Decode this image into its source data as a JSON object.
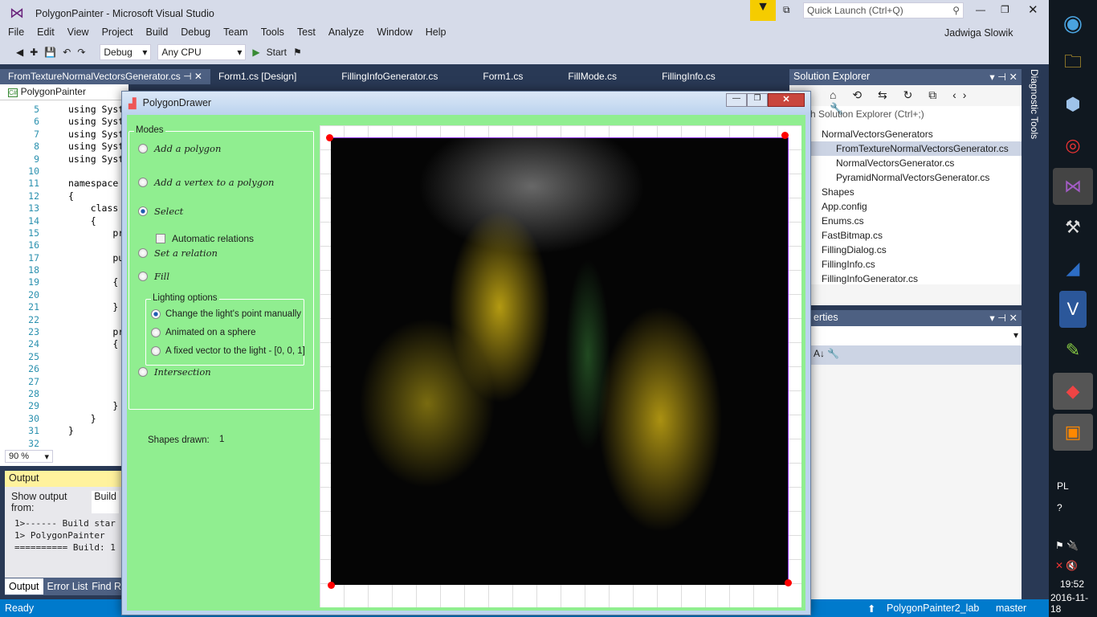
{
  "vs": {
    "title": "PolygonPainter - Microsoft Visual Studio",
    "quick_launch": "Quick Launch (Ctrl+Q)",
    "user": "Jadwiga Slowik",
    "menu": [
      "File",
      "Edit",
      "View",
      "Project",
      "Build",
      "Debug",
      "Team",
      "Tools",
      "Test",
      "Analyze",
      "Window",
      "Help"
    ],
    "config": "Debug",
    "platform": "Any CPU",
    "start": "Start",
    "tabs": [
      "FromTextureNormalVectorsGenerator.cs",
      "Form1.cs [Design]",
      "FillingInfoGenerator.cs",
      "Form1.cs",
      "FillMode.cs",
      "FillingInfo.cs"
    ],
    "project_combo": "PolygonPainter",
    "code_lines": [
      {
        "n": "5",
        "t": "using Syst",
        "k": "kw"
      },
      {
        "n": "6",
        "t": "using Syst",
        "k": "dim"
      },
      {
        "n": "7",
        "t": "using Syst",
        "k": "dim"
      },
      {
        "n": "8",
        "t": "using Syst",
        "k": "dim"
      },
      {
        "n": "9",
        "t": "using Syst",
        "k": "dim"
      },
      {
        "n": "10",
        "t": "",
        "k": ""
      },
      {
        "n": "11",
        "t": "namespace",
        "k": "kw"
      },
      {
        "n": "12",
        "t": "{",
        "k": ""
      },
      {
        "n": "13",
        "t": "    class",
        "k": "kw"
      },
      {
        "n": "14",
        "t": "    {",
        "k": ""
      },
      {
        "n": "15",
        "t": "        pr",
        "k": "kw"
      },
      {
        "n": "16",
        "t": "",
        "k": ""
      },
      {
        "n": "17",
        "t": "        pu",
        "k": "kw"
      },
      {
        "n": "18",
        "t": "",
        "k": ""
      },
      {
        "n": "19",
        "t": "        {",
        "k": ""
      },
      {
        "n": "20",
        "t": "",
        "k": ""
      },
      {
        "n": "21",
        "t": "        }",
        "k": ""
      },
      {
        "n": "22",
        "t": "",
        "k": ""
      },
      {
        "n": "23",
        "t": "        pr",
        "k": "kw"
      },
      {
        "n": "24",
        "t": "        {",
        "k": ""
      },
      {
        "n": "25",
        "t": "",
        "k": ""
      },
      {
        "n": "26",
        "t": "",
        "k": ""
      },
      {
        "n": "27",
        "t": "",
        "k": ""
      },
      {
        "n": "28",
        "t": "",
        "k": ""
      },
      {
        "n": "29",
        "t": "        }",
        "k": ""
      },
      {
        "n": "30",
        "t": "    }",
        "k": ""
      },
      {
        "n": "31",
        "t": "}",
        "k": ""
      },
      {
        "n": "32",
        "t": "",
        "k": ""
      }
    ],
    "zoom": "90 %",
    "output": {
      "title": "Output",
      "show_from": "Show output from:",
      "source": "Build",
      "lines": [
        "1>------ Build star",
        "1>  PolygonPainter",
        "========== Build: 1"
      ],
      "tabs": [
        "Output",
        "Error List",
        "Find R"
      ]
    },
    "status": {
      "ready": "Ready",
      "project": "PolygonPainter2_lab",
      "branch": "master"
    },
    "solution_explorer": {
      "title": "Solution Explorer",
      "search": "ch Solution Explorer (Ctrl+;)",
      "items": [
        "NormalVectorsGenerators",
        "FromTextureNormalVectorsGenerator.cs",
        "NormalVectorsGenerator.cs",
        "PyramidNormalVectorsGenerator.cs",
        "Shapes",
        "App.config",
        "Enums.cs",
        "FastBitmap.cs",
        "FillingDialog.cs",
        "FillingInfo.cs",
        "FillingInfoGenerator.cs"
      ]
    },
    "properties": {
      "title": "erties"
    },
    "diagnostic": "Diagnostic Tools"
  },
  "tray": {
    "lang": "PL",
    "time": "19:52",
    "date": "2016-11-18"
  },
  "drawer": {
    "title": "PolygonDrawer",
    "modes_label": "Modes",
    "modes": [
      {
        "label": "Add a polygon",
        "checked": false
      },
      {
        "label": "Add a vertex to a polygon",
        "checked": false
      },
      {
        "label": "Select",
        "checked": true
      },
      {
        "label": "Set a relation",
        "checked": false
      },
      {
        "label": "Fill",
        "checked": false
      },
      {
        "label": "Intersection",
        "checked": false
      }
    ],
    "auto_relations": "Automatic relations",
    "lighting_label": "Lighting options",
    "lighting": [
      {
        "label": "Change the light's point manually",
        "checked": true
      },
      {
        "label": "Animated on a sphere",
        "checked": false
      },
      {
        "label": "A fixed vector to the light - [0, 0, 1]",
        "checked": false
      }
    ],
    "shapes_label": "Shapes drawn:",
    "shapes_count": "1"
  }
}
